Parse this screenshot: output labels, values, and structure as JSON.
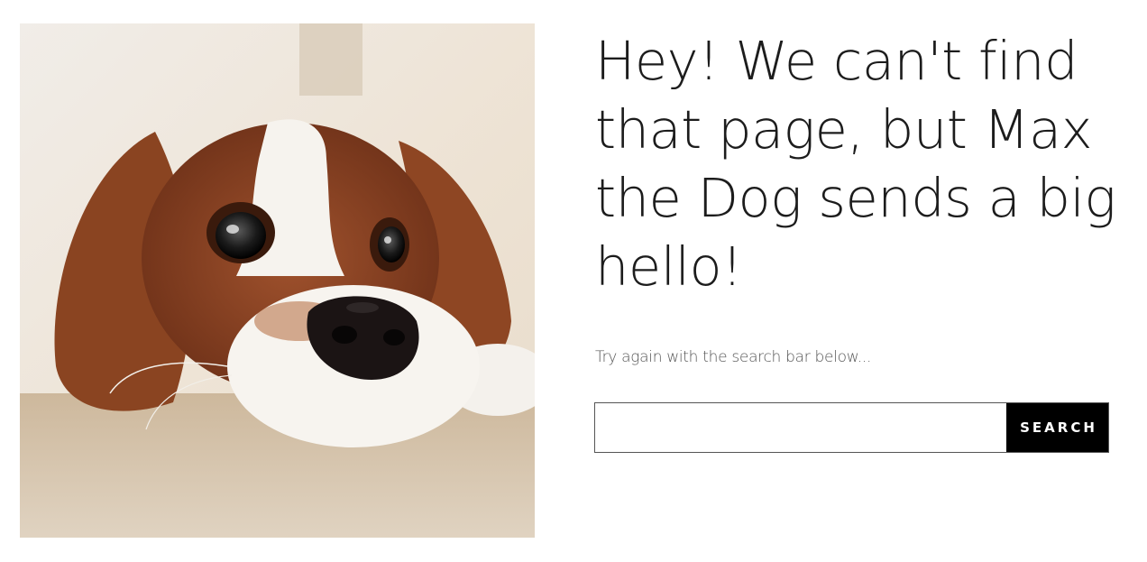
{
  "page": {
    "headline": "Hey! We can't find that page, but Max the Dog sends a big hello!",
    "subtext": "Try again with the search bar below...",
    "image_subject": "cavalier-king-charles-spaniel-photo"
  },
  "search": {
    "value": "",
    "placeholder": "",
    "button_label": "SEARCH"
  },
  "colors": {
    "text": "#1c1c1c",
    "subtext": "#555555",
    "button_bg": "#000000",
    "button_text": "#ffffff",
    "border": "#555555"
  }
}
